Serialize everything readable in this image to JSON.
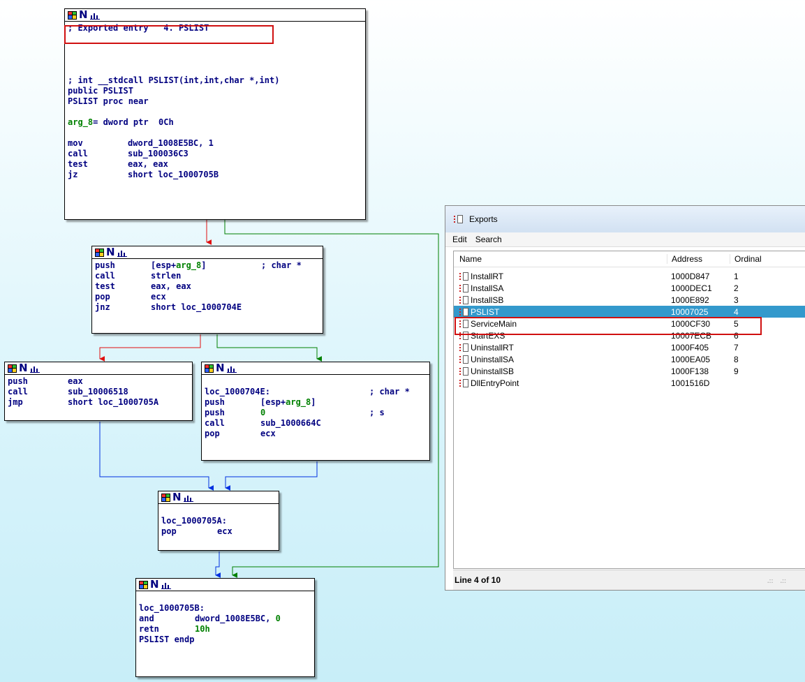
{
  "graph": {
    "node1": {
      "exported": "; Exported entry   4. PSLIST",
      "proto": "; int __stdcall PSLIST(int,int,char *,int)",
      "public": "public PSLIST",
      "proc": "PSLIST proc near",
      "arg_name": "arg_8",
      "arg_rest": "= dword ptr  0Ch",
      "lines": [
        {
          "m": "mov",
          "o": "dword_1008E5BC, 1"
        },
        {
          "m": "call",
          "o": "sub_100036C3"
        },
        {
          "m": "test",
          "o": "eax, eax"
        },
        {
          "m": "jz",
          "o": "short loc_1000705B"
        }
      ]
    },
    "node2": {
      "l1_m": "push",
      "l1_pre": "[esp+",
      "l1_arg": "arg_8",
      "l1_post": "]",
      "l1_cmt": "; char *",
      "lines": [
        {
          "m": "call",
          "o": "strlen"
        },
        {
          "m": "test",
          "o": "eax, eax"
        },
        {
          "m": "pop",
          "o": "ecx"
        },
        {
          "m": "jnz",
          "o": "short loc_1000704E"
        }
      ]
    },
    "node3": {
      "lines": [
        {
          "m": "push",
          "o": "eax"
        },
        {
          "m": "call",
          "o": "sub_10006518"
        },
        {
          "m": "jmp",
          "o": "short loc_1000705A"
        }
      ]
    },
    "node4": {
      "label": "loc_1000704E:",
      "label_cmt": "; char *",
      "l2_m": "push",
      "l2_pre": "[esp+",
      "l2_arg": "arg_8",
      "l2_post": "]",
      "l3_m": "push",
      "l3_o": "0",
      "l3_cmt": "; s",
      "lines": [
        {
          "m": "call",
          "o": "sub_1000664C"
        },
        {
          "m": "pop",
          "o": "ecx"
        }
      ]
    },
    "node5": {
      "label": "loc_1000705A:",
      "lines": [
        {
          "m": "pop",
          "o": "ecx"
        }
      ]
    },
    "node6": {
      "label": "loc_1000705B:",
      "l2_m": "and",
      "l2_o": "dword_1008E5BC, ",
      "l2_num": "0",
      "l3_m": "retn",
      "l3_o": "10h",
      "endp": "PSLIST endp"
    }
  },
  "exports": {
    "title": "Exports",
    "menu": [
      "Edit",
      "Search"
    ],
    "columns": {
      "name": "Name",
      "address": "Address",
      "ordinal": "Ordinal"
    },
    "rows": [
      {
        "name": "InstallRT",
        "address": "1000D847",
        "ordinal": "1"
      },
      {
        "name": "InstallSA",
        "address": "1000DEC1",
        "ordinal": "2"
      },
      {
        "name": "InstallSB",
        "address": "1000E892",
        "ordinal": "3"
      },
      {
        "name": "PSLIST",
        "address": "10007025",
        "ordinal": "4"
      },
      {
        "name": "ServiceMain",
        "address": "1000CF30",
        "ordinal": "5"
      },
      {
        "name": "StartEXS",
        "address": "10007ECB",
        "ordinal": "6"
      },
      {
        "name": "UninstallRT",
        "address": "1000F405",
        "ordinal": "7"
      },
      {
        "name": "UninstallSA",
        "address": "1000EA05",
        "ordinal": "8"
      },
      {
        "name": "UninstallSB",
        "address": "1000F138",
        "ordinal": "9"
      },
      {
        "name": "DllEntryPoint",
        "address": "1001516D",
        "ordinal": ""
      }
    ],
    "selected_index": 3,
    "status": "Line 4 of 10"
  },
  "colors": {
    "true_edge": "#008000",
    "false_edge": "#e01010",
    "uncond_edge": "#0030e0",
    "selection": "#3399cc",
    "highlight_box": "#d01010"
  }
}
